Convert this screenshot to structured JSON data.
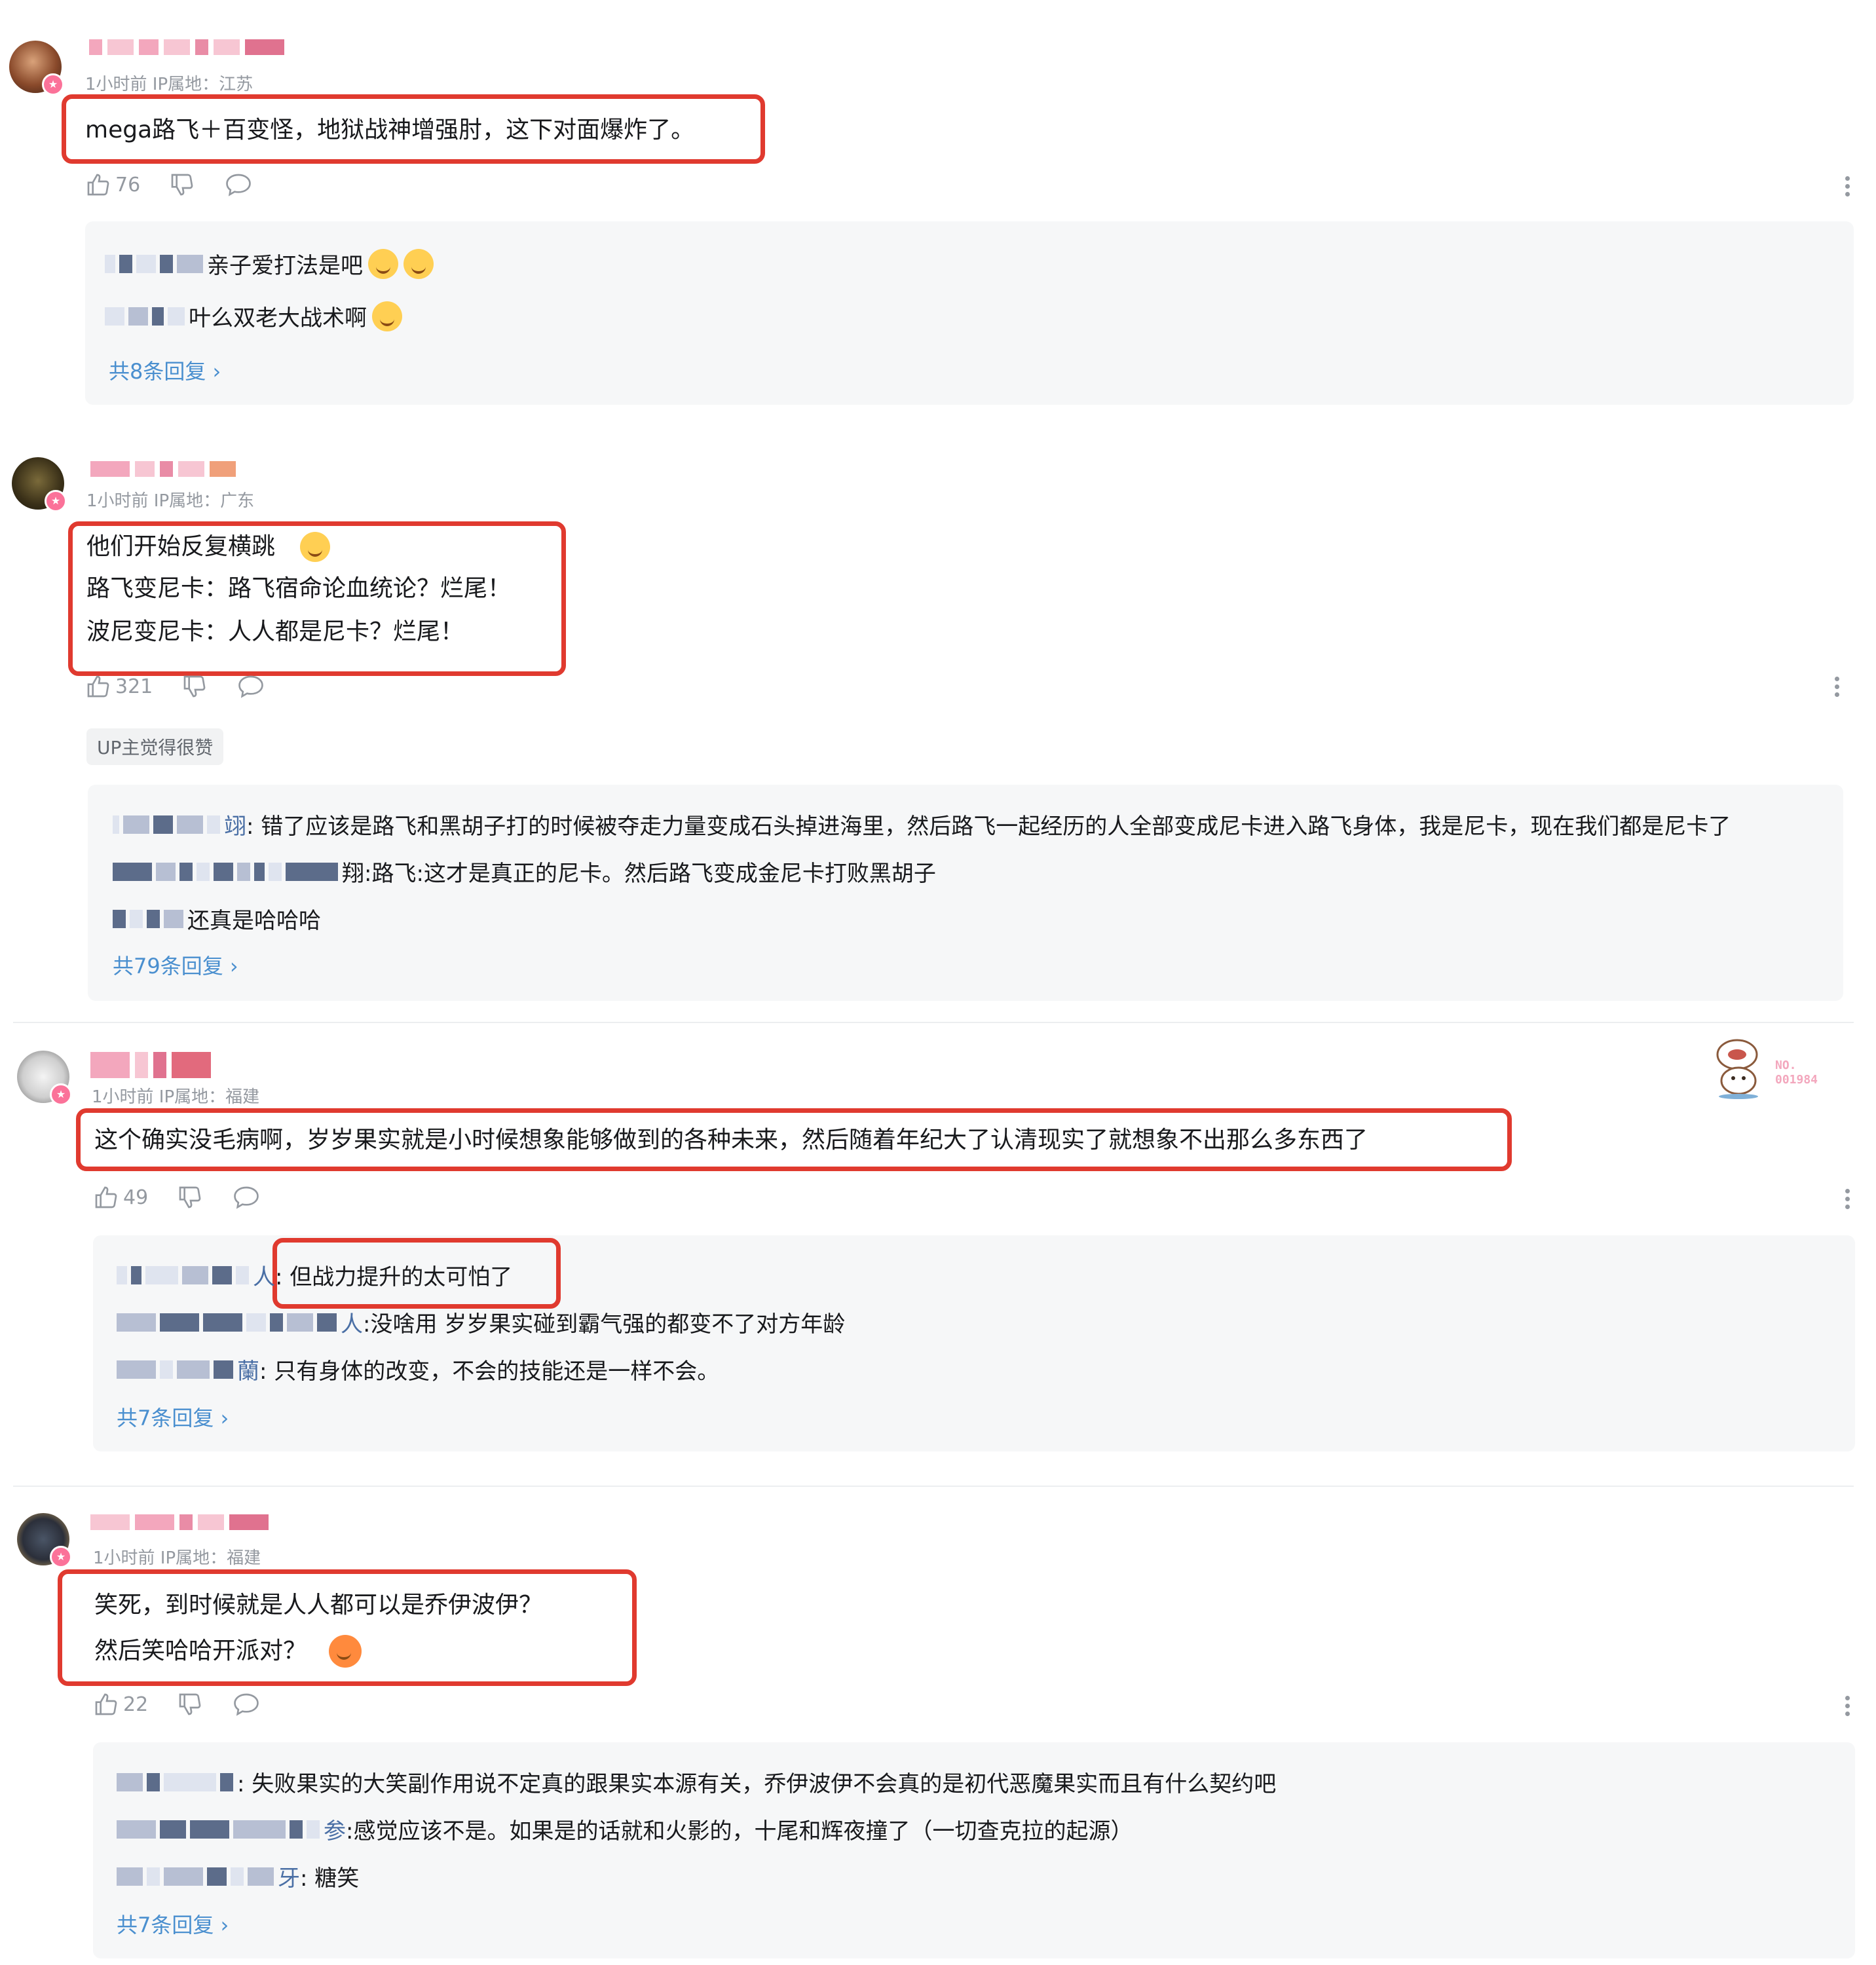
{
  "accent_color": "#e03a2f",
  "link_color": "#4a8fcf",
  "comments": [
    {
      "meta": "1小时前  IP属地：江苏",
      "lines": [
        "mega路飞＋百变怪，地狱战神增强肘，这下对面爆炸了。"
      ],
      "likes": "76",
      "replies": [
        {
          "name": "",
          "text": "亲子爱打法是吧",
          "emoji": [
            "doge-emoji",
            "doge-emoji"
          ]
        },
        {
          "name": "",
          "text": "叶么双老大战术啊",
          "emoji": [
            "doge-emoji"
          ]
        }
      ],
      "reply_count": "共8条回复 ›"
    },
    {
      "meta": "1小时前  IP属地：广东",
      "lines": [
        "他们开始反复横跳",
        "路飞变尼卡：路飞宿命论血统论？烂尾！",
        "波尼变尼卡：人人都是尼卡？烂尾！"
      ],
      "likes": "321",
      "up_tag": "UP主觉得很赞",
      "replies": [
        {
          "name": "翊",
          "text": ": 错了应该是路飞和黑胡子打的时候被夺走力量变成石头掉进海里，然后路飞一起经历的人全部变成尼卡进入路飞身体，我是尼卡，现在我们都是尼卡了"
        },
        {
          "name": "翔",
          "text": " :路飞:这才是真正的尼卡。然后路飞变成金尼卡打败黑胡子"
        },
        {
          "name": "",
          "text": "还真是哈哈哈"
        }
      ],
      "reply_count": "共79条回复 ›"
    },
    {
      "meta": "1小时前  IP属地：福建",
      "lines": [
        "这个确实没毛病啊，岁岁果实就是小时候想象能够做到的各种未来，然后随着年纪大了认清现实了就想象不出那么多东西了"
      ],
      "likes": "49",
      "sticker_text": "NO. 001984",
      "replies": [
        {
          "name": "人",
          "text": ": 但战力提升的太可怕了"
        },
        {
          "name": "人",
          "text": " :没啥用  岁岁果实碰到霸气强的都变不了对方年龄"
        },
        {
          "name": "蘭",
          "text": ": 只有身体的改变，不会的技能还是一样不会。"
        }
      ],
      "reply_count": "共7条回复 ›"
    },
    {
      "meta": "1小时前  IP属地：福建",
      "lines": [
        "笑死，到时候就是人人都可以是乔伊波伊？",
        "然后笑哈哈开派对？"
      ],
      "likes": "22",
      "replies": [
        {
          "name": "",
          "text": ": 失败果实的大笑副作用说不定真的跟果实本源有关，乔伊波伊不会真的是初代恶魔果实而且有什么契约吧"
        },
        {
          "name": "参",
          "text": " :感觉应该不是。如果是的话就和火影的，十尾和辉夜撞了（一切查克拉的起源）"
        },
        {
          "name": "牙",
          "text": ": 糖笑"
        }
      ],
      "reply_count": "共7条回复 ›"
    }
  ]
}
